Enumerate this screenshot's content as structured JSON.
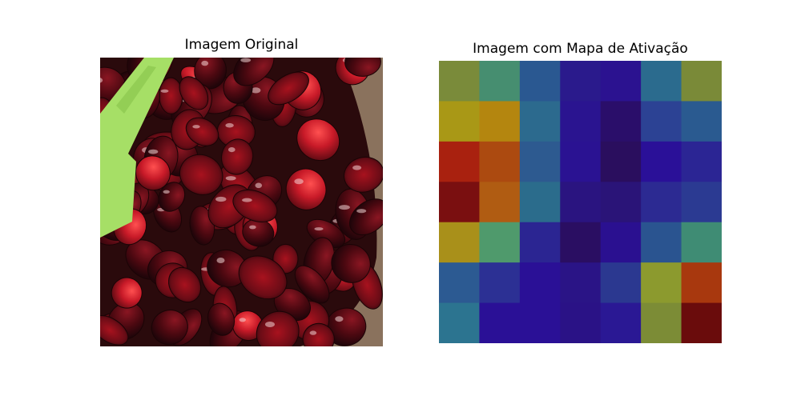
{
  "figure": {
    "left_title": "Imagem Original",
    "right_title": "Imagem com Mapa de Ativação"
  },
  "photo": {
    "subject": "bowl of halved dark red cherries with a green spatula in a clear plastic container",
    "colors": {
      "background": "#2a0a0c",
      "cherry_dark": "#4a0810",
      "cherry_mid": "#7a0f1a",
      "cherry_bright": "#c81a28",
      "highlight": "#f3d6d6",
      "spatula": "#a6df66",
      "container": "#d9c9a0"
    }
  },
  "chart_data": {
    "type": "heatmap",
    "rows": 7,
    "cols": 7,
    "cells": [
      [
        "#7a8b3a",
        "#468e70",
        "#2a5891",
        "#2a1a8c",
        "#2b1290",
        "#2b6b8e",
        "#7a8a38"
      ],
      [
        "#a99816",
        "#b4860f",
        "#2c6a8e",
        "#2a1490",
        "#2a0e6a",
        "#2c4294",
        "#2a5a90"
      ],
      [
        "#a9210f",
        "#ac4a10",
        "#2d5a90",
        "#2a1292",
        "#2a0e5e",
        "#2a1098",
        "#2b2594"
      ],
      [
        "#7a0f10",
        "#b05c12",
        "#2b6c8c",
        "#2a1480",
        "#2a1478",
        "#2c2a92",
        "#2b3a92"
      ],
      [
        "#a9901a",
        "#4f9a6c",
        "#2b2592",
        "#2a0e62",
        "#2a1090",
        "#2a5490",
        "#3f8c74"
      ],
      [
        "#2c5a92",
        "#2c3094",
        "#2a1096",
        "#2a1486",
        "#2b3890",
        "#8c9a2e",
        "#a8380e"
      ],
      [
        "#2c7490",
        "#2a1096",
        "#2a1096",
        "#2a1286",
        "#2a1894",
        "#7c8c36",
        "#6a0c0c"
      ]
    ]
  }
}
